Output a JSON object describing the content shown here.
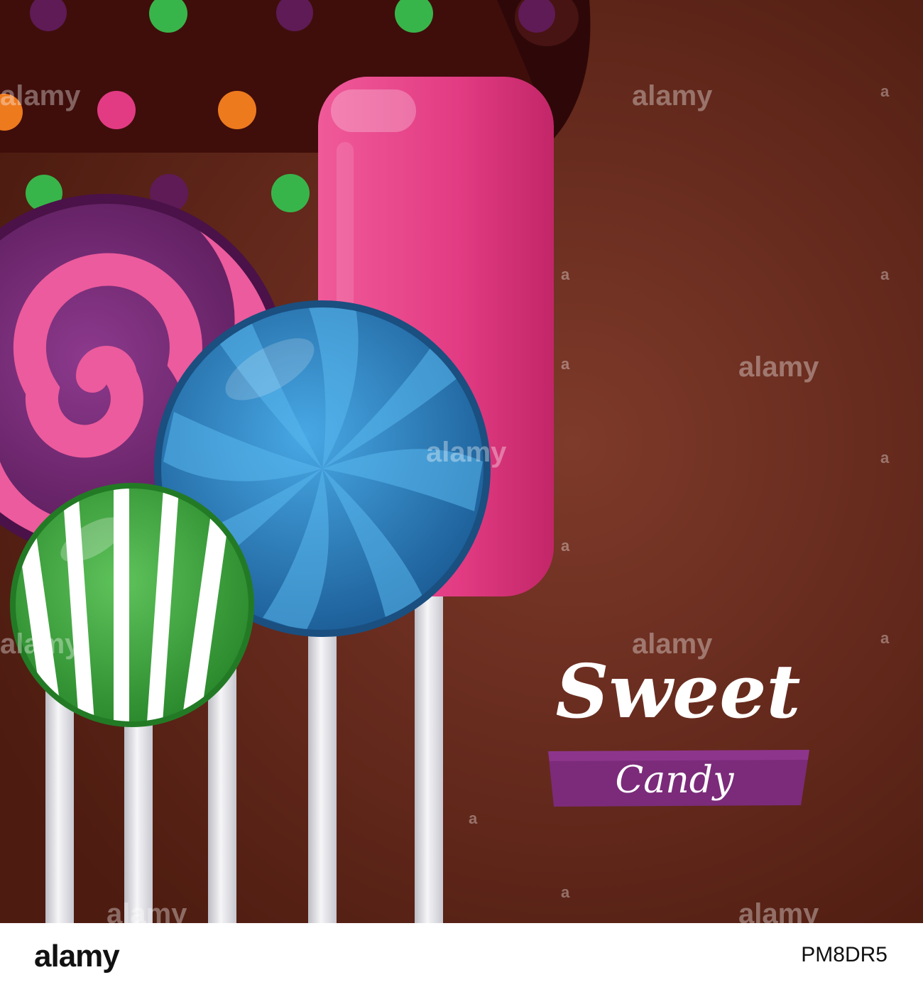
{
  "poster": {
    "headline": "Sweet",
    "ribbon_text": "Candy",
    "watermark": "alamy"
  },
  "footer": {
    "logo": "alamy",
    "image_id": "PM8DR5"
  },
  "colors": {
    "background_center": "#7a3a28",
    "background_edge": "#4a1a10",
    "pink": "#e8357f",
    "purple": "#7b2a7b",
    "blue": "#2f8ed0",
    "green": "#3fae3f",
    "stick": "#e8e8ec",
    "ribbon": "#7b2b7a"
  }
}
